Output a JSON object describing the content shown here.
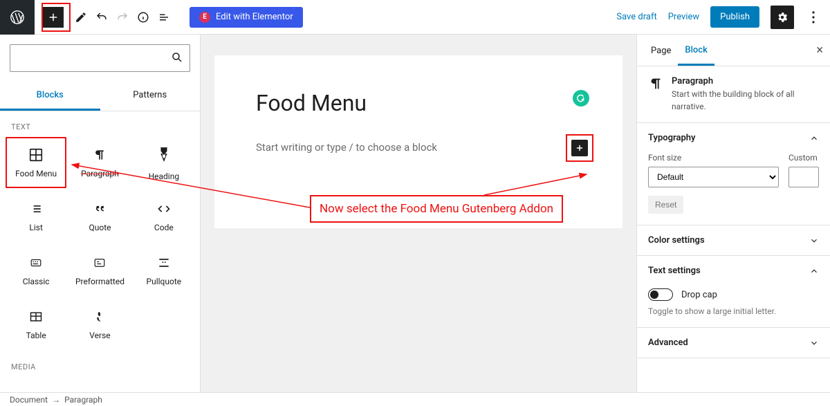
{
  "topbar": {
    "elementor_label": "Edit with Elementor",
    "save_draft": "Save draft",
    "preview": "Preview",
    "publish": "Publish"
  },
  "inserter": {
    "search_placeholder": "",
    "tabs": {
      "blocks": "Blocks",
      "patterns": "Patterns"
    },
    "cat_text": "TEXT",
    "cat_media": "MEDIA",
    "blocks": {
      "food_menu": "Food Menu",
      "paragraph": "Paragraph",
      "heading": "Heading",
      "list": "List",
      "quote": "Quote",
      "code": "Code",
      "classic": "Classic",
      "preformatted": "Preformatted",
      "pullquote": "Pullquote",
      "table": "Table",
      "verse": "Verse"
    }
  },
  "canvas": {
    "title": "Food Menu",
    "placeholder": "Start writing or type / to choose a block"
  },
  "annotation": {
    "text": "Now select the Food Menu Gutenberg Addon"
  },
  "settings": {
    "tabs": {
      "page": "Page",
      "block": "Block"
    },
    "block_name": "Paragraph",
    "block_desc": "Start with the building block of all narrative.",
    "typography": "Typography",
    "font_size": "Font size",
    "custom": "Custom",
    "font_size_value": "Default",
    "reset": "Reset",
    "color_settings": "Color settings",
    "text_settings": "Text settings",
    "drop_cap": "Drop cap",
    "drop_cap_help": "Toggle to show a large initial letter.",
    "advanced": "Advanced"
  },
  "footer": {
    "crumb1": "Document",
    "crumb2": "Paragraph"
  }
}
